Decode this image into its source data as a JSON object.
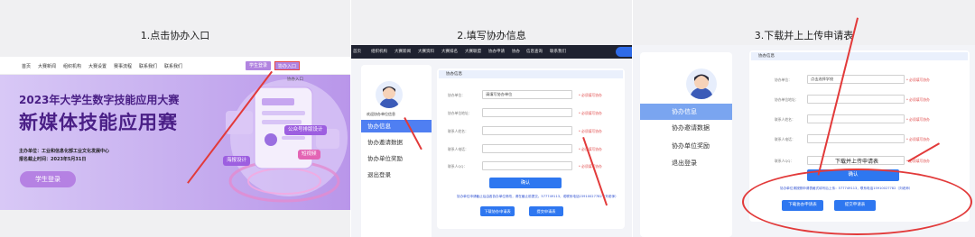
{
  "steps": {
    "step1": "1.点击协办入口",
    "step2": "2.填写协办信息",
    "step3": "3.下载并上上传申请表"
  },
  "panel1": {
    "nav": [
      "首页",
      "大赛新闻",
      "组织机构",
      "大赛设置",
      "赛事流程",
      "联系我们",
      "联系我们"
    ],
    "student_login": "学生登录",
    "co_entry": "协办入口",
    "hero_title1": "2023年大学生数字技能应用大赛",
    "hero_title2": "新媒体技能应用赛",
    "organizer": "主办单位：工业和信息化部工业文化发展中心",
    "deadline": "报名截止时间：2023年5月31日",
    "login_button": "学生登录",
    "tags": [
      "公众号排版设计",
      "短视频",
      "海报设计"
    ],
    "corner_label": "协办入口"
  },
  "panel2": {
    "nav": [
      "首页",
      "组织机构",
      "大赛新闻",
      "大赛资料",
      "大赛排名",
      "大赛联盟",
      "协办申请",
      "协办",
      "信息查询",
      "联系我们"
    ],
    "user_caption": "欢迎协办单位信息",
    "menu": [
      "协办信息",
      "协办邀请数据",
      "协办单位奖励",
      "退出登录"
    ],
    "form_title": "协办信息",
    "fields": [
      {
        "label": "协办单位：",
        "value": "请填写协办单位",
        "hint": "* 必须填写协办"
      },
      {
        "label": "协办单位地址：",
        "value": "",
        "hint": "* 必须填写协办"
      },
      {
        "label": "联系人姓名：",
        "value": "",
        "hint": "* 必须填写协办"
      },
      {
        "label": "联系人电话：",
        "value": "",
        "hint": "* 必须填写协办"
      },
      {
        "label": "联系人QQ：",
        "value": "",
        "hint": "* 必须填写协办"
      }
    ],
    "confirm": "确认",
    "note": "协办单位申请截止后由各协办单位修改，请在截止前提交。577749113，或联系电话15910027782（刘老师）",
    "download": "下载协办申请表",
    "submit": "提交申请表"
  },
  "panel3": {
    "menu": [
      "协办信息",
      "协办邀请数据",
      "协办单位奖励",
      "退出登录"
    ],
    "form_title": "协办信息",
    "fields": [
      {
        "label": "协办单位：",
        "value": "点击选择学校",
        "hint": "* 必须填写协办"
      },
      {
        "label": "协办单位地址：",
        "value": "",
        "hint": "* 必须填写协办"
      },
      {
        "label": "联系人姓名：",
        "value": "",
        "hint": "* 必须填写协办"
      },
      {
        "label": "联系人电话：",
        "value": "",
        "hint": "* 必须填写协办"
      },
      {
        "label": "联系人QQ：",
        "value": "",
        "hint": "* 必须填写协办"
      }
    ],
    "confirm": "确认",
    "upload_caption": "下载并上传申请表",
    "note": "协办单位请按照申请表格式填写后上传：577749113，联系电话15910027782（刘老师）",
    "download": "下载协办申请表",
    "submit": "提交申请表"
  },
  "colors": {
    "accent_purple": "#b184e0",
    "accent_blue": "#2e77f0",
    "annotation_red": "#e23a3a"
  }
}
